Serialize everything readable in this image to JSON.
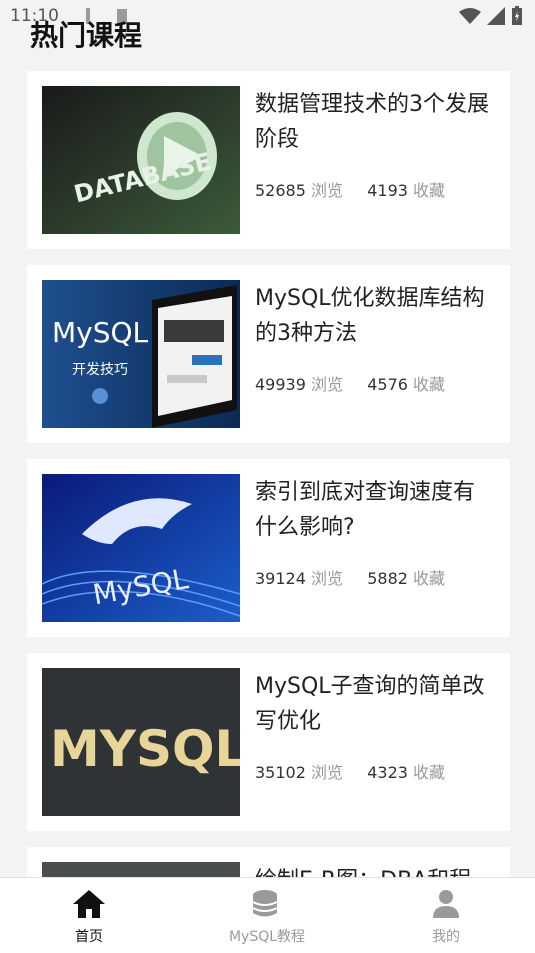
{
  "status_bar": {
    "time": "11:10"
  },
  "page": {
    "title": "热门课程"
  },
  "courses": [
    {
      "title": "数据管理技术的3个发展阶段",
      "views": "52685",
      "views_label": "浏览",
      "favorites": "4193",
      "favorites_label": "收藏",
      "thumb_text": "DATABASE"
    },
    {
      "title": "MySQL优化数据库结构的3种方法",
      "views": "49939",
      "views_label": "浏览",
      "favorites": "4576",
      "favorites_label": "收藏",
      "thumb_text": "MySQL",
      "thumb_subtext": "开发技巧"
    },
    {
      "title": "索引到底对查询速度有什么影响?",
      "views": "39124",
      "views_label": "浏览",
      "favorites": "5882",
      "favorites_label": "收藏",
      "thumb_text": "MySQL"
    },
    {
      "title": "MySQL子查询的简单改写优化",
      "views": "35102",
      "views_label": "浏览",
      "favorites": "4323",
      "favorites_label": "收藏",
      "thumb_text": "MYSQL"
    },
    {
      "title": "绘制E-R图：DBA和程"
    }
  ],
  "tabs": [
    {
      "label": "首页",
      "icon": "home-icon",
      "active": true
    },
    {
      "label": "MySQL教程",
      "icon": "database-icon",
      "active": false
    },
    {
      "label": "我的",
      "icon": "user-icon",
      "active": false
    }
  ],
  "colors": {
    "active_tab": "#111111",
    "inactive_tab": "#9a9a9a"
  }
}
